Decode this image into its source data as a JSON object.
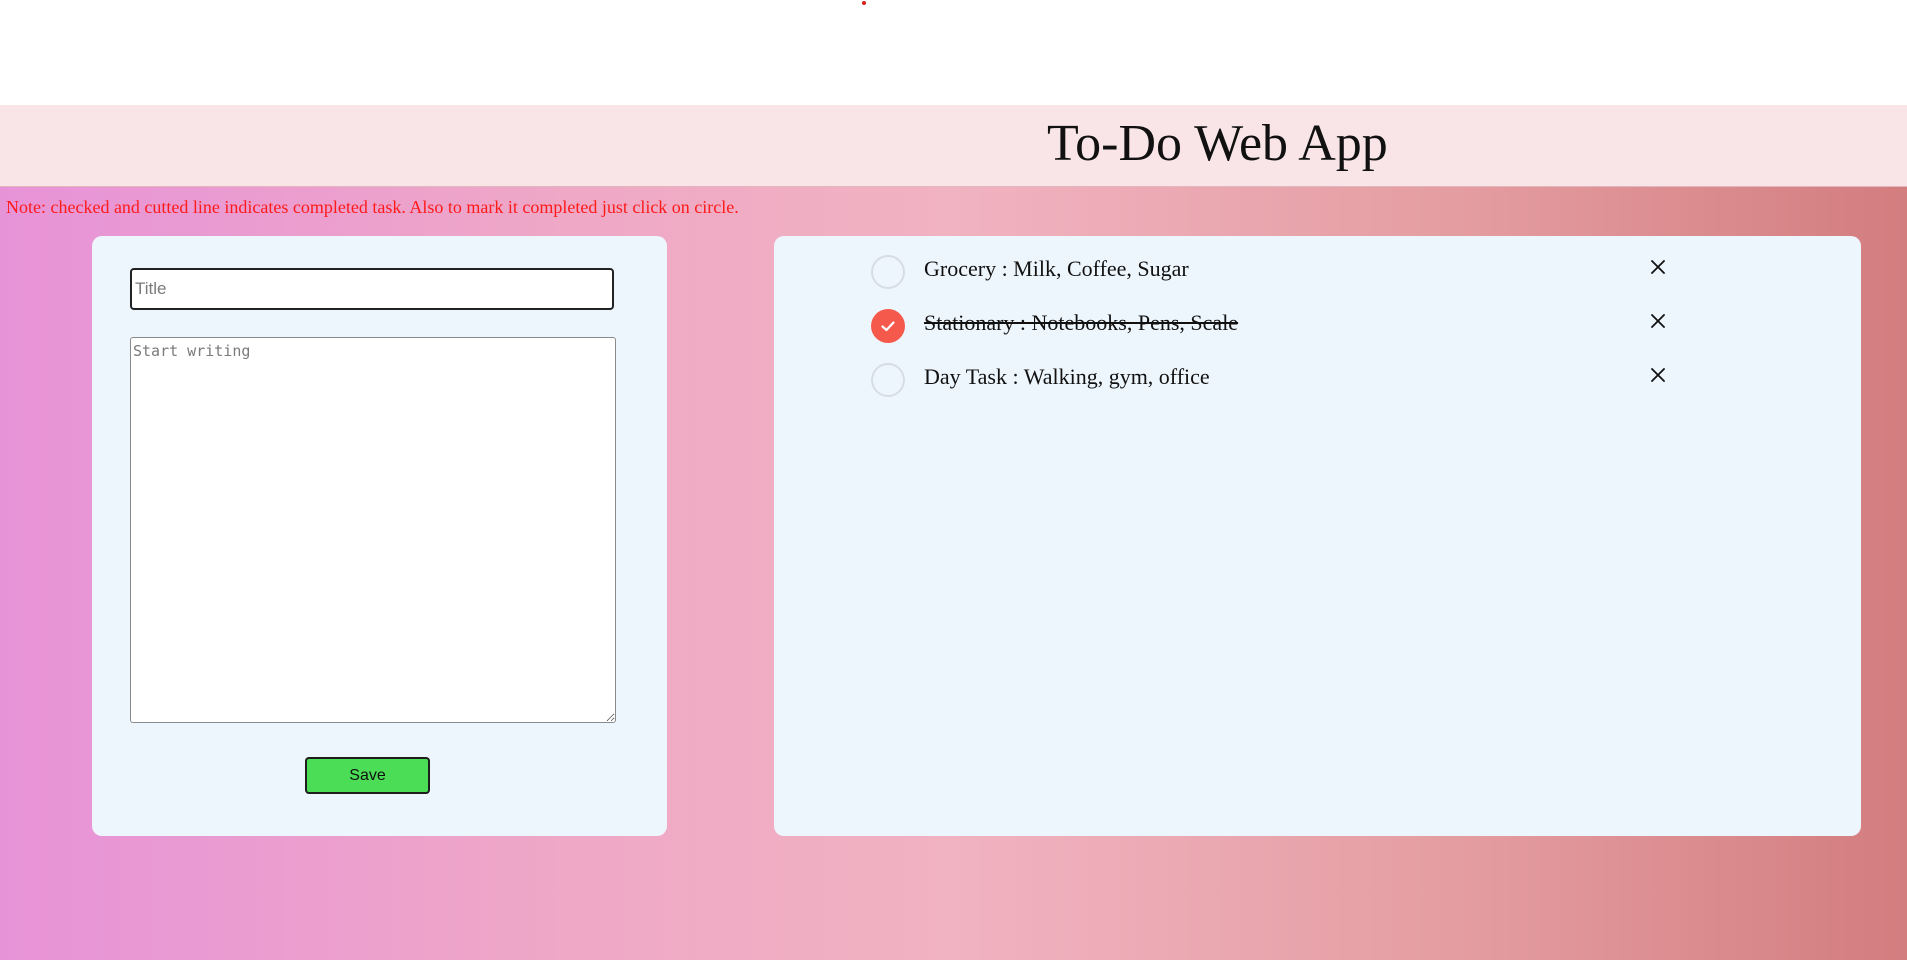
{
  "header": {
    "title": "To-Do Web App"
  },
  "note": {
    "text": "Note: checked and cutted line indicates completed task. Also to mark it completed just click on circle."
  },
  "form": {
    "title_placeholder": "Title",
    "title_value": "",
    "body_placeholder": "Start writing",
    "body_value": "",
    "save_label": "Save"
  },
  "tasks": [
    {
      "text": "Grocery : Milk, Coffee, Sugar",
      "completed": false
    },
    {
      "text": "Stationary : Notebooks, Pens, Scale",
      "completed": true
    },
    {
      "text": "Day Task : Walking, gym, office",
      "completed": false
    }
  ],
  "icons": {
    "check": "check-icon",
    "delete": "close-icon"
  },
  "colors": {
    "completed_circle": "#f5594b",
    "save_button": "#4bdd56",
    "note_text": "#ff1a1a",
    "header_background": "#f9e5e7",
    "card_background": "#eef6fd"
  }
}
